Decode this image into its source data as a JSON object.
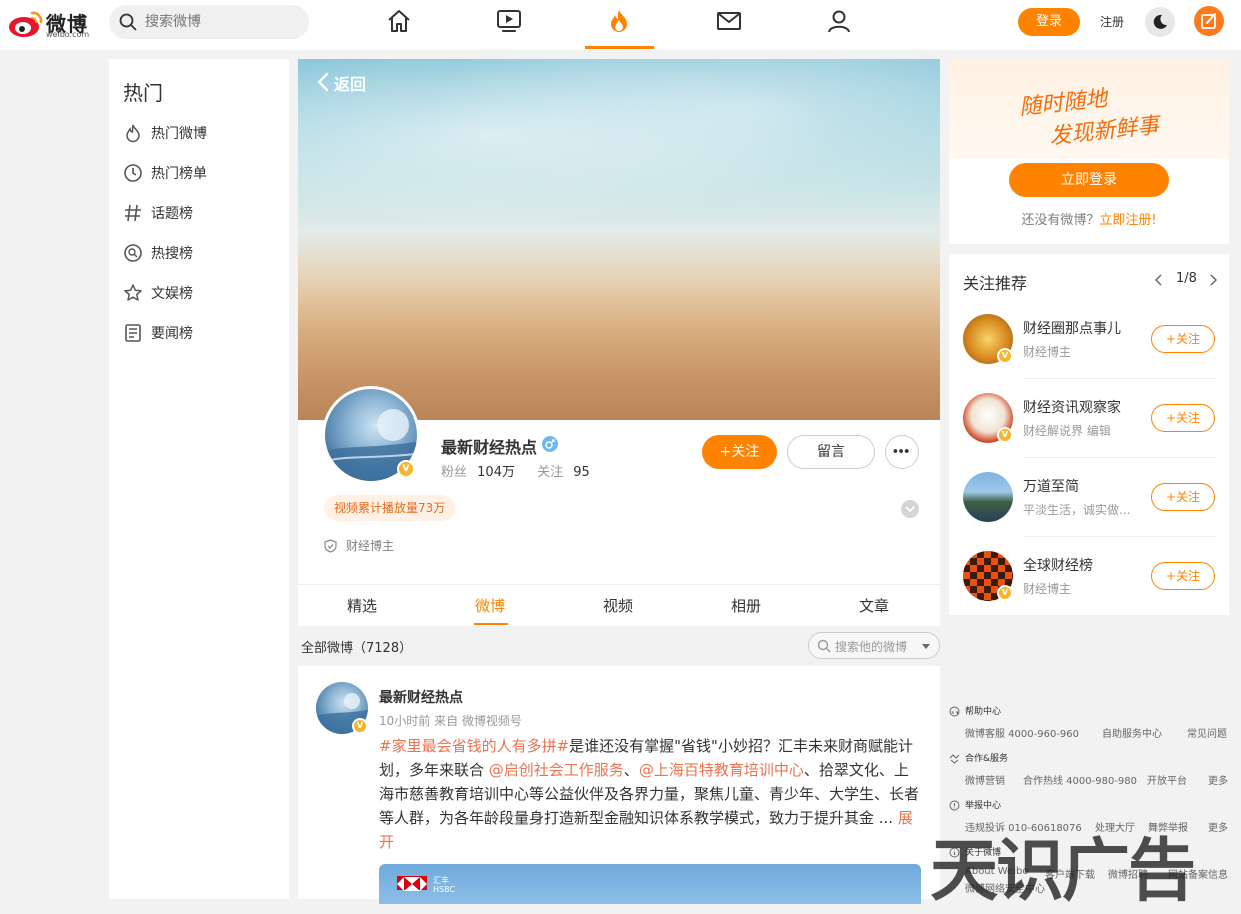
{
  "brand": {
    "name": "微博",
    "url": "weibo.com"
  },
  "header": {
    "search_placeholder": "搜索微博",
    "nav": [
      {
        "icon": "home-icon"
      },
      {
        "icon": "video-icon"
      },
      {
        "icon": "hot-icon",
        "active": true
      },
      {
        "icon": "mail-icon"
      },
      {
        "icon": "user-icon"
      }
    ],
    "login_label": "登录",
    "register_label": "注册"
  },
  "leftbar": {
    "title": "热门",
    "items": [
      {
        "label": "热门微博",
        "icon": "flame-icon"
      },
      {
        "label": "热门榜单",
        "icon": "clock-icon"
      },
      {
        "label": "话题榜",
        "icon": "hashtag-icon"
      },
      {
        "label": "热搜榜",
        "icon": "search-circle-icon"
      },
      {
        "label": "文娱榜",
        "icon": "star-icon"
      },
      {
        "label": "要闻榜",
        "icon": "news-icon"
      }
    ]
  },
  "profile": {
    "back_label": "返回",
    "name": "最新财经热点",
    "fans_label": "粉丝",
    "fans_value": "104万",
    "following_label": "关注",
    "following_value": "95",
    "follow_label": "+关注",
    "message_label": "留言",
    "tag": "视频累计播放量73万",
    "role": "财经博主"
  },
  "tabs": [
    {
      "label": "精选"
    },
    {
      "label": "微博",
      "active": true
    },
    {
      "label": "视频"
    },
    {
      "label": "相册"
    },
    {
      "label": "文章"
    }
  ],
  "feed": {
    "all_label": "全部微博（7128）",
    "search_placeholder": "搜索他的微博",
    "post": {
      "author": "最新财经热点",
      "meta": "10小时前  来自 微博视频号",
      "hashtag": "#家里最会省钱的人有多拼#",
      "text_a": "是谁还没有掌握\"省钱\"小妙招？汇丰未来财商赋能计划，多年来联合 ",
      "mention1": "@启创社会工作服务",
      "text_b": "、",
      "mention2": "@上海百特教育培训中心",
      "text_c": "、拾翠文化、上海市慈善教育培训中心等公益伙伴及各界力量，聚焦儿童、青少年、大学生、长者等人群，为各年龄段量身打造新型金融知识体系教学模式，致力于提升其金 ...",
      "expand_label": "展开",
      "image_brand_cn": "汇丰",
      "image_brand_en": "HSBC"
    }
  },
  "login_card": {
    "slogan_line1": "随时随地",
    "slogan_line2": "发现新鲜事",
    "login_button": "立即登录",
    "no_account": "还没有微博？",
    "register_now": "立即注册!"
  },
  "recommend": {
    "title": "关注推荐",
    "pager": "1/8",
    "follow_label": "+关注",
    "items": [
      {
        "name": "财经圈那点事儿",
        "desc": "财经博主"
      },
      {
        "name": "财经资讯观察家",
        "desc": "财经解说界 编辑"
      },
      {
        "name": "万道至简",
        "desc": "平淡生活，诚实做..."
      },
      {
        "name": "全球财经榜",
        "desc": "财经博主"
      }
    ]
  },
  "footer": {
    "help": {
      "title": "帮助中心",
      "links": [
        "微博客服 4000-960-960",
        "自助服务中心",
        "常见问题"
      ]
    },
    "coop": {
      "title": "合作&服务",
      "links": [
        "微博营销",
        "合作热线 4000-980-980",
        "开放平台",
        "更多"
      ]
    },
    "report": {
      "title": "举报中心",
      "links": [
        "违规投诉 010-60618076",
        "处理大厅",
        "舞弊举报",
        "更多"
      ]
    },
    "about": {
      "title": "关于微博",
      "links": [
        "About Weibo",
        "客户端下载",
        "微博招聘",
        "网站备案信息"
      ],
      "extra": "微博网络安全中心"
    }
  },
  "watermark": "天识广告",
  "colors": {
    "accent": "#ff8200",
    "link": "#eb7350"
  }
}
